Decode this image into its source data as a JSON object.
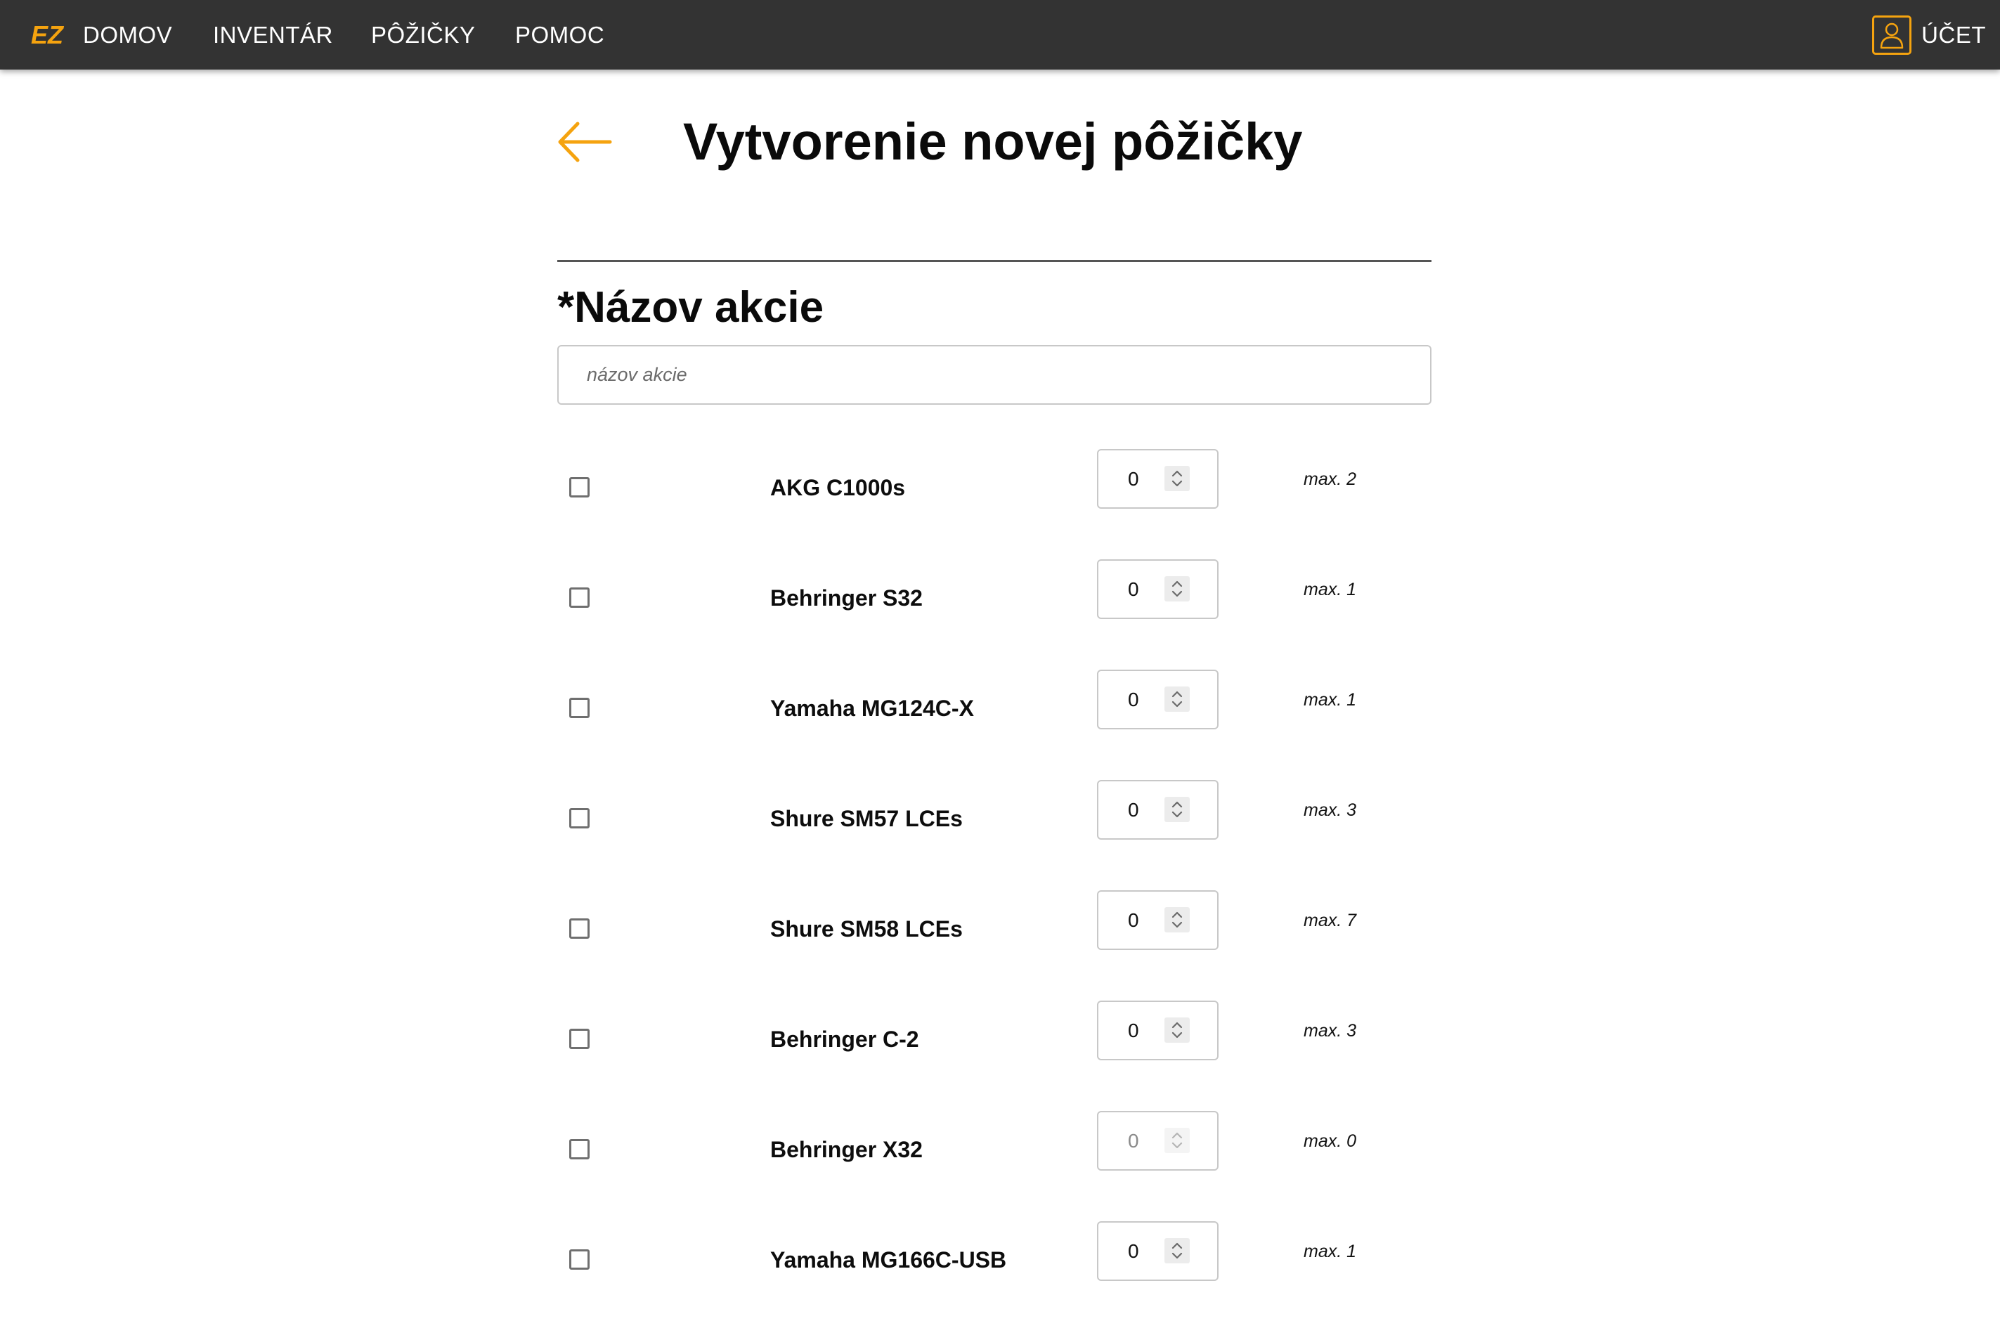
{
  "navbar": {
    "logo_text": "EZ",
    "links": [
      {
        "label": "DOMOV"
      },
      {
        "label": "INVENTÁR"
      },
      {
        "label": "PÔŽIČKY"
      },
      {
        "label": "POMOC"
      }
    ],
    "account_label": "ÚČET",
    "account_icon": "user-icon"
  },
  "colors": {
    "accent": "#f5a30f",
    "navbar_bg": "#333333"
  },
  "page": {
    "title": "Vytvorenie novej pôžičky",
    "back_icon": "arrow-left-icon"
  },
  "form": {
    "event_name_label": "*Názov akcie",
    "event_name_placeholder": "názov akcie",
    "event_name_value": ""
  },
  "items": [
    {
      "name": "AKG C1000s",
      "qty": "0",
      "max": "max. 2",
      "checked": false
    },
    {
      "name": "Behringer S32",
      "qty": "0",
      "max": "max. 1",
      "checked": false
    },
    {
      "name": "Yamaha MG124C-X",
      "qty": "0",
      "max": "max. 1",
      "checked": false
    },
    {
      "name": "Shure SM57 LCEs",
      "qty": "0",
      "max": "max. 3",
      "checked": false
    },
    {
      "name": "Shure SM58 LCEs",
      "qty": "0",
      "max": "max. 7",
      "checked": false
    },
    {
      "name": "Behringer C-2",
      "qty": "0",
      "max": "max. 3",
      "checked": false
    },
    {
      "name": "Behringer X32",
      "qty": "0",
      "max": "max. 0",
      "checked": false,
      "disabled": true
    },
    {
      "name": "Yamaha MG166C-USB",
      "qty": "0",
      "max": "max. 1",
      "checked": false
    }
  ]
}
